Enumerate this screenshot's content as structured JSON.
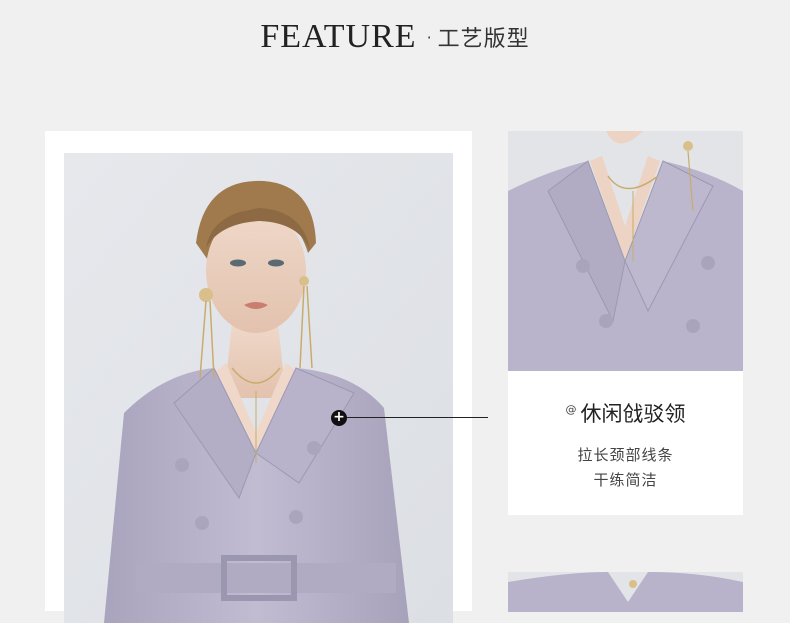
{
  "header": {
    "title_en": "FEATURE",
    "separator": "·",
    "title_cn": "工艺版型"
  },
  "feature": {
    "at_symbol": "@",
    "title": "休闲戗驳领",
    "line1": "拉长颈部线条",
    "line2": "干练简洁"
  },
  "hotspot": {
    "icon": "plus-icon",
    "symbol": "+"
  },
  "colors": {
    "page_bg": "#f0f0f0",
    "card_bg": "#ffffff",
    "blazer_lavender": "#b7b2c9",
    "photo_bg": "#e4e6ea"
  }
}
